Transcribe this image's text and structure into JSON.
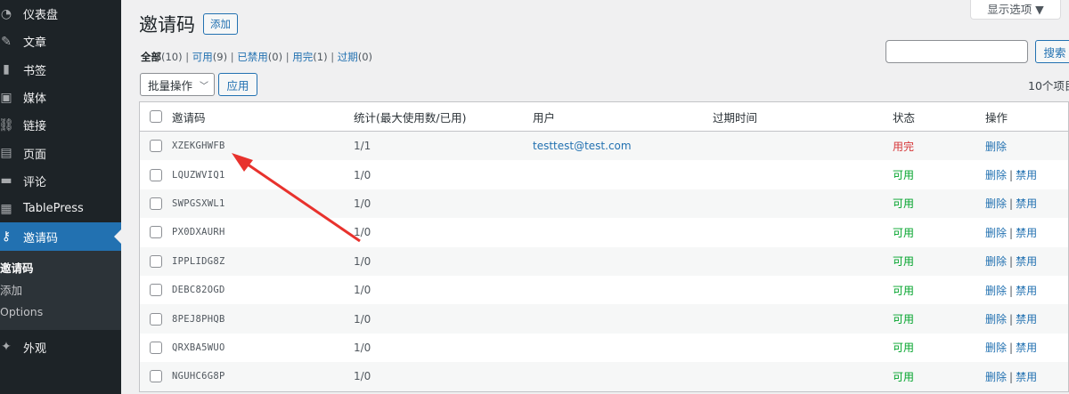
{
  "sidebar": {
    "items": [
      {
        "label": "仪表盘",
        "icon": "dashboard-icon",
        "glyph": "◔"
      },
      {
        "label": "文章",
        "icon": "pin-icon",
        "glyph": "✎"
      },
      {
        "label": "书签",
        "icon": "bookmark-icon",
        "glyph": "▮"
      },
      {
        "label": "媒体",
        "icon": "media-icon",
        "glyph": "▣"
      },
      {
        "label": "链接",
        "icon": "link-icon",
        "glyph": "⛓"
      },
      {
        "label": "页面",
        "icon": "page-icon",
        "glyph": "▤"
      },
      {
        "label": "评论",
        "icon": "comment-icon",
        "glyph": "▬"
      },
      {
        "label": "TablePress",
        "icon": "table-icon",
        "glyph": "▦"
      },
      {
        "label": "邀请码",
        "icon": "key-icon",
        "glyph": "⚷"
      }
    ],
    "submenu": [
      "邀请码",
      "添加",
      "Options"
    ],
    "after": [
      {
        "label": "外观",
        "icon": "appearance-icon",
        "glyph": "✦"
      }
    ]
  },
  "header": {
    "title": "邀请码",
    "add_label": "添加",
    "screen_options": "显示选项 ▼"
  },
  "filters": [
    {
      "label": "全部",
      "count": "(10)"
    },
    {
      "label": "可用",
      "count": "(9)"
    },
    {
      "label": "已禁用",
      "count": "(0)"
    },
    {
      "label": "用完",
      "count": "(1)"
    },
    {
      "label": "过期",
      "count": "(0)"
    }
  ],
  "search": {
    "button": "搜索",
    "placeholder": ""
  },
  "bulk": {
    "select": "批量操作",
    "apply": "应用",
    "items_count": "10个项目"
  },
  "table": {
    "headers": {
      "code": "邀请码",
      "stats": "统计(最大使用数/已用)",
      "user": "用户",
      "expiry": "过期时间",
      "status": "状态",
      "actions": "操作"
    },
    "rows": [
      {
        "code": "XZEKGHWFB",
        "stats": "1/1",
        "user": "testtest@test.com",
        "status": "用完",
        "delete": "删除",
        "disable": ""
      },
      {
        "code": "LQUZWVIQ1",
        "stats": "1/0",
        "user": "",
        "status": "可用",
        "delete": "删除",
        "disable": "禁用"
      },
      {
        "code": "SWPGSXWL1",
        "stats": "1/0",
        "user": "",
        "status": "可用",
        "delete": "删除",
        "disable": "禁用"
      },
      {
        "code": "PX0DXAURH",
        "stats": "1/0",
        "user": "",
        "status": "可用",
        "delete": "删除",
        "disable": "禁用"
      },
      {
        "code": "IPPLIDG8Z",
        "stats": "1/0",
        "user": "",
        "status": "可用",
        "delete": "删除",
        "disable": "禁用"
      },
      {
        "code": "DEBC82OGD",
        "stats": "1/0",
        "user": "",
        "status": "可用",
        "delete": "删除",
        "disable": "禁用"
      },
      {
        "code": "8PEJ8PHQB",
        "stats": "1/0",
        "user": "",
        "status": "可用",
        "delete": "删除",
        "disable": "禁用"
      },
      {
        "code": "QRXBA5WUO",
        "stats": "1/0",
        "user": "",
        "status": "可用",
        "delete": "删除",
        "disable": "禁用"
      },
      {
        "code": "NGUHC6G8P",
        "stats": "1/0",
        "user": "",
        "status": "可用",
        "delete": "删除",
        "disable": "禁用"
      }
    ]
  },
  "colors": {
    "sidebar_bg": "#1d2327",
    "active_bg": "#2271b1",
    "link": "#2271b1",
    "status_used": "#d63638",
    "status_available": "#00a32a",
    "annotation_arrow": "#e8322d"
  }
}
